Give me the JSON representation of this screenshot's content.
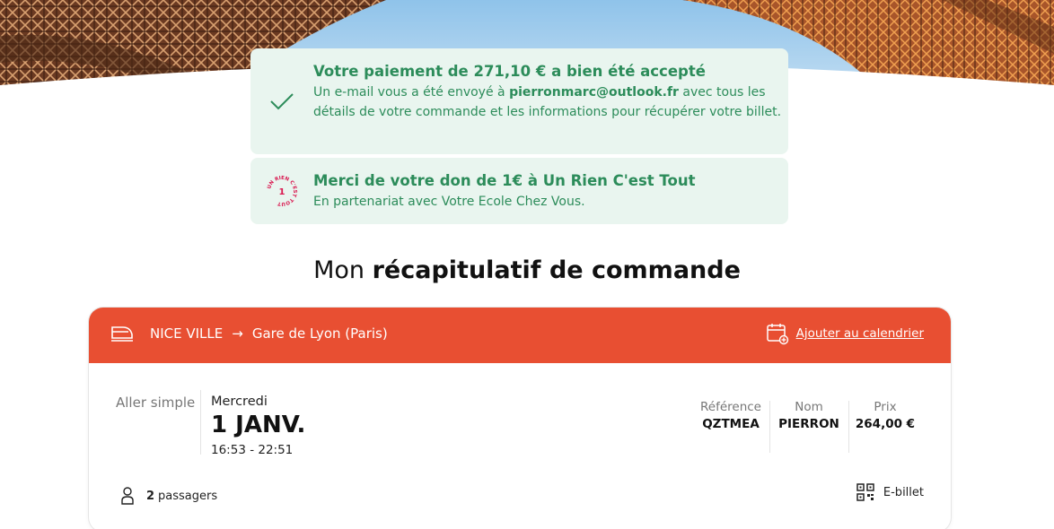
{
  "payment_alert": {
    "title": "Votre paiement de 271,10 € a bien été accepté",
    "body_prefix": "Un e-mail vous a été envoyé à ",
    "email": "pierronmarc@outlook.fr",
    "body_suffix": " avec tous les détails de votre commande et les informations pour récupérer votre billet.",
    "icon": "checkmark-icon"
  },
  "donation_alert": {
    "title": "Merci de votre don de 1€ à Un Rien C'est Tout",
    "body": "En partenariat avec Votre Ecole Chez Vous.",
    "logo_text": "UN RIEN C'EST TOUT",
    "logo_number": "1"
  },
  "summary": {
    "heading_light": "Mon ",
    "heading_bold": "récapitulatif de commande"
  },
  "trip": {
    "origin": "NICE VILLE",
    "arrow": "→",
    "destination": "Gare de Lyon (Paris)",
    "calendar_link": "Ajouter au calendrier",
    "type": "Aller simple",
    "weekday": "Mercredi",
    "date": "1 JANV.",
    "hours": "16:53 - 22:51",
    "reference_label": "Référence",
    "reference": "QZTMEA",
    "name_label": "Nom",
    "name": "PIERRON",
    "price_label": "Prix",
    "price": "264,00 €",
    "passengers_count": "2",
    "passengers_label": "passagers",
    "ticket_label": "E-billet"
  },
  "colors": {
    "accent": "#e84f32",
    "success": "#2c8c5a",
    "success_bg": "#e9f5ef",
    "donation_logo": "#d9174f"
  }
}
